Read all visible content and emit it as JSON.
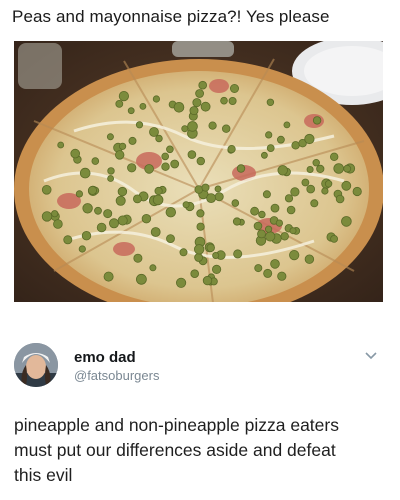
{
  "post": {
    "caption": "Peas and mayonnaise pizza?! Yes please"
  },
  "image": {
    "subject_icon": "pizza-photo"
  },
  "tweet": {
    "display_name": "emo dad",
    "handle": "@fatsoburgers",
    "text_lines": [
      "pineapple and non-pineapple pizza eaters",
      "must put our differences aside and defeat",
      "this evil"
    ],
    "menu_icon": "chevron-down-icon"
  },
  "colors": {
    "crust": "#c98f4d",
    "cheese": "#e3d4a8",
    "peas": "#7b8b3c",
    "table": "#4a3424",
    "handle_gray": "#7b8893"
  }
}
